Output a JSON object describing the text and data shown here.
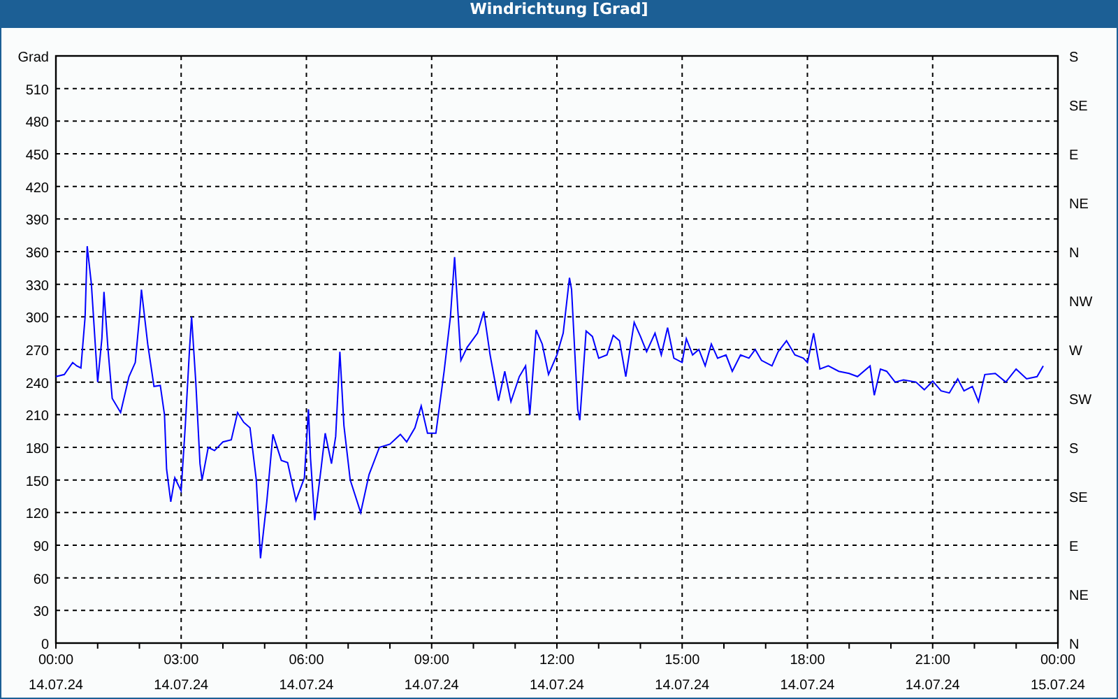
{
  "window": {
    "title": "Windrichtung [Grad]"
  },
  "chart": {
    "chart_data": {
      "type": "line",
      "ylabel": "Grad",
      "xlim": [
        0,
        24
      ],
      "ylim": [
        0,
        540
      ],
      "xticks": [
        {
          "value": 0,
          "label": "00:00"
        },
        {
          "value": 3,
          "label": "03:00"
        },
        {
          "value": 6,
          "label": "06:00"
        },
        {
          "value": 9,
          "label": "09:00"
        },
        {
          "value": 12,
          "label": "12:00"
        },
        {
          "value": 15,
          "label": "15:00"
        },
        {
          "value": 18,
          "label": "18:00"
        },
        {
          "value": 21,
          "label": "21:00"
        },
        {
          "value": 24,
          "label": "00:00"
        }
      ],
      "yticks": [
        0,
        30,
        60,
        90,
        120,
        150,
        180,
        210,
        240,
        270,
        300,
        330,
        360,
        390,
        420,
        450,
        480,
        510
      ],
      "x": [
        0.0,
        0.2,
        0.4,
        0.5,
        0.6,
        0.7,
        0.75,
        0.85,
        0.9,
        1.0,
        1.1,
        1.15,
        1.25,
        1.35,
        1.55,
        1.75,
        1.9,
        2.0,
        2.05,
        2.2,
        2.35,
        2.5,
        2.6,
        2.65,
        2.75,
        2.85,
        3.0,
        3.1,
        3.2,
        3.25,
        3.35,
        3.45,
        3.5,
        3.65,
        3.8,
        4.0,
        4.2,
        4.35,
        4.5,
        4.65,
        4.8,
        4.9,
        5.05,
        5.2,
        5.4,
        5.55,
        5.75,
        5.95,
        6.05,
        6.1,
        6.2,
        6.35,
        6.45,
        6.6,
        6.7,
        6.8,
        6.9,
        7.05,
        7.3,
        7.5,
        7.75,
        8.0,
        8.25,
        8.4,
        8.6,
        8.75,
        8.9,
        9.1,
        9.3,
        9.45,
        9.55,
        9.7,
        9.85,
        10.1,
        10.25,
        10.4,
        10.6,
        10.75,
        10.9,
        11.1,
        11.25,
        11.35,
        11.5,
        11.65,
        11.8,
        12.0,
        12.15,
        12.3,
        12.35,
        12.5,
        12.55,
        12.7,
        12.85,
        13.0,
        13.2,
        13.35,
        13.5,
        13.65,
        13.85,
        14.0,
        14.15,
        14.35,
        14.5,
        14.65,
        14.8,
        15.0,
        15.1,
        15.25,
        15.4,
        15.55,
        15.7,
        15.85,
        16.05,
        16.2,
        16.4,
        16.6,
        16.75,
        16.9,
        17.15,
        17.3,
        17.5,
        17.7,
        17.9,
        18.0,
        18.15,
        18.3,
        18.5,
        18.75,
        19.0,
        19.2,
        19.5,
        19.6,
        19.75,
        19.9,
        20.1,
        20.3,
        20.6,
        20.8,
        21.0,
        21.2,
        21.4,
        21.6,
        21.75,
        21.95,
        22.1,
        22.25,
        22.5,
        22.75,
        23.0,
        23.25,
        23.5,
        23.65
      ],
      "grid": true,
      "series": [
        {
          "color": "#0000ff",
          "values": [
            245,
            247,
            258,
            255,
            253,
            300,
            365,
            330,
            300,
            240,
            280,
            323,
            270,
            225,
            212,
            245,
            258,
            300,
            325,
            275,
            236,
            237,
            210,
            160,
            130,
            152,
            140,
            200,
            270,
            300,
            240,
            165,
            150,
            180,
            177,
            185,
            187,
            212,
            203,
            198,
            150,
            78,
            130,
            192,
            168,
            166,
            131,
            152,
            215,
            170,
            113,
            160,
            193,
            165,
            190,
            268,
            200,
            150,
            120,
            155,
            180,
            183,
            192,
            185,
            198,
            218,
            193,
            193,
            250,
            300,
            355,
            260,
            272,
            285,
            305,
            265,
            223,
            250,
            222,
            245,
            255,
            210,
            288,
            275,
            247,
            265,
            285,
            336,
            325,
            215,
            205,
            287,
            282,
            262,
            265,
            283,
            278,
            245,
            295,
            282,
            268,
            285,
            265,
            290,
            262,
            258,
            280,
            265,
            270,
            255,
            275,
            262,
            265,
            250,
            265,
            262,
            270,
            260,
            255,
            268,
            278,
            265,
            262,
            258,
            285,
            252,
            255,
            250,
            248,
            245,
            255,
            228,
            252,
            250,
            240,
            242,
            240,
            233,
            241,
            232,
            230,
            243,
            232,
            236,
            222,
            247,
            248,
            240,
            252,
            243,
            245,
            255
          ]
        }
      ]
    },
    "x_axis_dates": [
      "14.07.24",
      "14.07.24",
      "14.07.24",
      "14.07.24",
      "14.07.24",
      "14.07.24",
      "14.07.24",
      "14.07.24",
      "15.07.24"
    ],
    "right_axis": {
      "ticks": [
        "S",
        "SE",
        "E",
        "NE",
        "N",
        "NW",
        "W",
        "SW",
        "S",
        "SE",
        "E",
        "NE",
        "N"
      ]
    }
  }
}
